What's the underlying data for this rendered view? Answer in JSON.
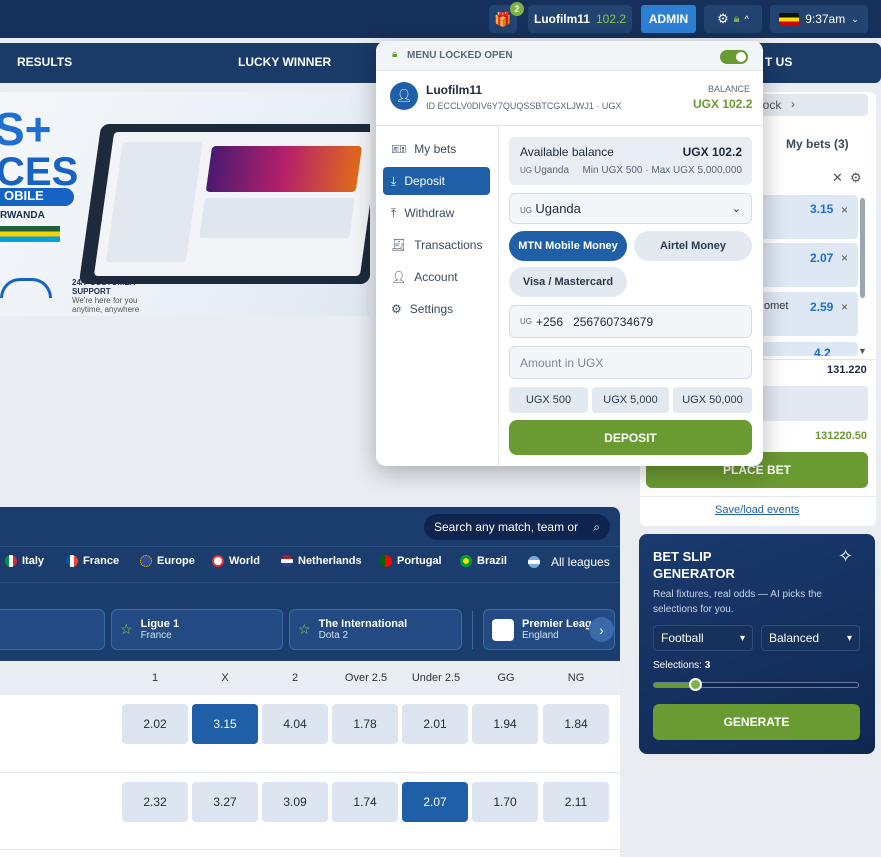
{
  "topbar": {
    "gift_count": "2",
    "username": "Luofilm11",
    "balance": "102.2",
    "admin_label": "ADMIN",
    "time": "9:37am"
  },
  "nav": {
    "results": "RESULTS",
    "lucky_winner": "LUCKY WINNER",
    "contact": "T US"
  },
  "banner": {
    "line1": "S+",
    "line2": "CES",
    "line3": "OBILE",
    "line4": "RWANDA",
    "support1": "24/7 CUSTOMER",
    "support2": "SUPPORT",
    "support3": "We're here for you",
    "support4": "anytime, anywhere"
  },
  "popup": {
    "lock_label": "MENU LOCKED OPEN",
    "user_name": "Luofilm11",
    "user_id": "ID ECCLV0DIV6Y7QUQSSBTCGXLJWJ1 · UGX",
    "balance_caption": "BALANCE",
    "balance_value": "UGX 102.2",
    "menu": [
      {
        "label": "My bets",
        "icon": "ticket-icon"
      },
      {
        "label": "Deposit",
        "icon": "download-icon"
      },
      {
        "label": "Withdraw",
        "icon": "upload-icon"
      },
      {
        "label": "Transactions",
        "icon": "receipt-icon"
      },
      {
        "label": "Account",
        "icon": "person-icon"
      },
      {
        "label": "Settings",
        "icon": "gear-icon"
      }
    ],
    "available_label": "Available balance",
    "available_value": "UGX 102.2",
    "country_code_small": "UG",
    "country_line": "Uganda",
    "limits": "Min UGX 500 · Max UGX 5,000,000",
    "country_select": "Uganda",
    "methods": [
      "MTN Mobile Money",
      "Airtel Money",
      "Visa / Mastercard"
    ],
    "phone_prefix": "+256",
    "phone_value": "256760734679",
    "amount_placeholder": "Amount in UGX",
    "quick_amounts": [
      "UGX 500",
      "UGX 5,000",
      "UGX 50,000"
    ],
    "deposit_button": "DEPOSIT"
  },
  "slip": {
    "tab_lock": "lock",
    "tab_mybets": "My bets (3)",
    "items": [
      {
        "odds": "3.15",
        "label": ""
      },
      {
        "odds": "2.07",
        "label": ""
      },
      {
        "odds": "2.59",
        "label": "omet"
      },
      {
        "odds": "4.2",
        "label": ""
      }
    ],
    "total_odds": "131.220",
    "payout": "131220.50",
    "place_bet": "PLACE BET",
    "save_load": "Save/load events"
  },
  "generator": {
    "title1": "BET SLIP",
    "title2": "GENERATOR",
    "description": "Real fixtures, real odds — AI picks the selections for you.",
    "sport": "Football",
    "mode": "Balanced",
    "selections_label": "Selections:",
    "selections_value": "3",
    "selections_level": 0.2,
    "button": "GENERATE"
  },
  "matches": {
    "search_placeholder": "Search any match, team or lea",
    "leagues": [
      "Italy",
      "France",
      "Europe",
      "World",
      "Netherlands",
      "Portugal",
      "Brazil",
      "All leagues"
    ],
    "cards": [
      {
        "name": "Ligue 1",
        "sub": "France"
      },
      {
        "name": "The International",
        "sub": "Dota 2"
      },
      {
        "name": "Premier League",
        "sub": "England"
      }
    ],
    "columns": [
      "1",
      "X",
      "2",
      "Over 2.5",
      "Under 2.5",
      "GG",
      "NG"
    ],
    "rows": [
      [
        "2.02",
        "3.15",
        "4.04",
        "1.78",
        "2.01",
        "1.94",
        "1.84"
      ],
      [
        "2.32",
        "3.27",
        "3.09",
        "1.74",
        "2.07",
        "1.70",
        "2.11"
      ]
    ]
  },
  "colors": {
    "brand_dark": "#15305a",
    "accent_blue": "#1f5fa8",
    "accent_green": "#6a9a32"
  }
}
